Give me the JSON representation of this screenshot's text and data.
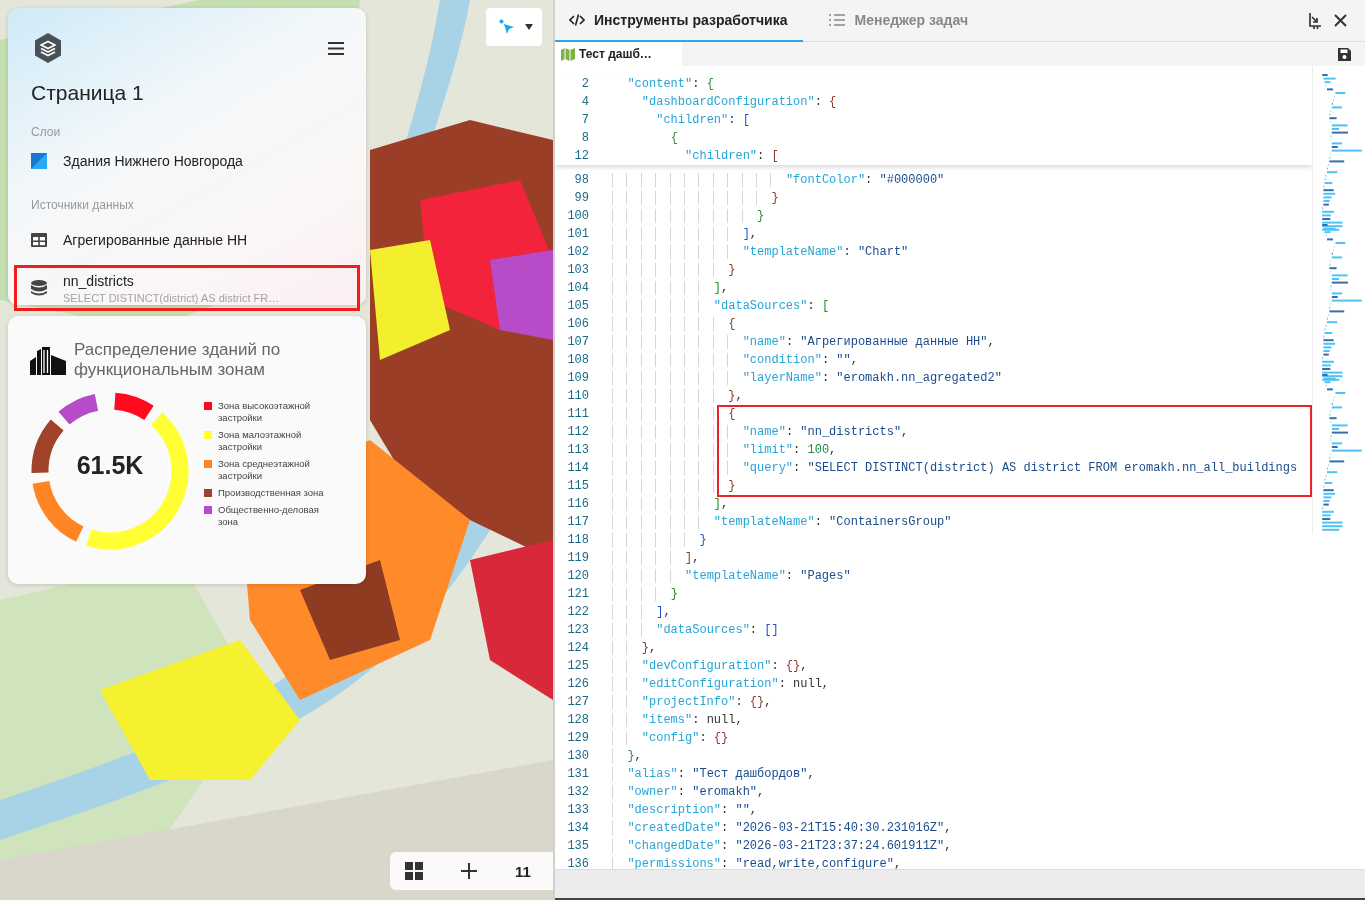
{
  "map_controls": {
    "zoom_level": "11"
  },
  "page_panel": {
    "title": "Страница 1",
    "layers_heading": "Слои",
    "layers": [
      {
        "name": "Здания Нижнего Новгорода"
      }
    ],
    "sources_heading": "Источники данных",
    "sources": [
      {
        "kind": "table",
        "name": "Агрегированные данные НН",
        "highlighted": false
      },
      {
        "kind": "database",
        "name": "nn_districts",
        "query": "SELECT DISTINCT(district) AS district FR…",
        "highlighted": true
      }
    ]
  },
  "chart_card": {
    "title": "Распределение зданий по функциональным зонам",
    "total": "61.5K",
    "legend": [
      {
        "label": "Зона высокоэтажной застройки",
        "color": "#ff0a1f"
      },
      {
        "label": "Зона малоэтажной застройки",
        "color": "#ffff33"
      },
      {
        "label": "Зона среднеэтажной застройки",
        "color": "#ff8424"
      },
      {
        "label": "Производственная зона",
        "color": "#a0432a"
      },
      {
        "label": "Общественно-деловая зона",
        "color": "#b64cc8"
      }
    ]
  },
  "devtools": {
    "tabs": [
      {
        "label": "Инструменты разработчика",
        "selected": true
      },
      {
        "label": "Менеджер задач",
        "selected": false
      }
    ],
    "file_tab": {
      "label": "Тест дашб…"
    },
    "sticky_lines": [
      {
        "number": "2",
        "text": "  \"content\": {"
      },
      {
        "number": "4",
        "text": "    \"dashboardConfiguration\": {"
      },
      {
        "number": "7",
        "text": "      \"children\": ["
      },
      {
        "number": "8",
        "text": "        {"
      },
      {
        "number": "12",
        "text": "          \"children\": ["
      }
    ],
    "lines": [
      {
        "number": "98",
        "text": "                        \"fontColor\": \"#000000\"",
        "highlighted": false
      },
      {
        "number": "99",
        "text": "                      }",
        "highlighted": false
      },
      {
        "number": "100",
        "text": "                    }",
        "highlighted": false
      },
      {
        "number": "101",
        "text": "                  ],",
        "highlighted": false
      },
      {
        "number": "102",
        "text": "                  \"templateName\": \"Chart\"",
        "highlighted": false
      },
      {
        "number": "103",
        "text": "                }",
        "highlighted": false
      },
      {
        "number": "104",
        "text": "              ],",
        "highlighted": false
      },
      {
        "number": "105",
        "text": "              \"dataSources\": [",
        "highlighted": false
      },
      {
        "number": "106",
        "text": "                {",
        "highlighted": false
      },
      {
        "number": "107",
        "text": "                  \"name\": \"Агрегированные данные НН\",",
        "highlighted": false
      },
      {
        "number": "108",
        "text": "                  \"condition\": \"\",",
        "highlighted": false
      },
      {
        "number": "109",
        "text": "                  \"layerName\": \"eromakh.nn_agregated2\"",
        "highlighted": false
      },
      {
        "number": "110",
        "text": "                },",
        "highlighted": false
      },
      {
        "number": "111",
        "text": "                {",
        "highlighted": true
      },
      {
        "number": "112",
        "text": "                  \"name\": \"nn_districts\",",
        "highlighted": true
      },
      {
        "number": "113",
        "text": "                  \"limit\": 100,",
        "highlighted": true
      },
      {
        "number": "114",
        "text": "                  \"query\": \"SELECT DISTINCT(district) AS district FROM eromakh.nn_all_buildings",
        "highlighted": true
      },
      {
        "number": "115",
        "text": "                }",
        "highlighted": true
      },
      {
        "number": "116",
        "text": "              ],",
        "highlighted": false
      },
      {
        "number": "117",
        "text": "              \"templateName\": \"ContainersGroup\"",
        "highlighted": false
      },
      {
        "number": "118",
        "text": "            }",
        "highlighted": false
      },
      {
        "number": "119",
        "text": "          ],",
        "highlighted": false
      },
      {
        "number": "120",
        "text": "          \"templateName\": \"Pages\"",
        "highlighted": false
      },
      {
        "number": "121",
        "text": "        }",
        "highlighted": false
      },
      {
        "number": "122",
        "text": "      ],",
        "highlighted": false
      },
      {
        "number": "123",
        "text": "      \"dataSources\": []",
        "highlighted": false
      },
      {
        "number": "124",
        "text": "    },",
        "highlighted": false
      },
      {
        "number": "125",
        "text": "    \"devConfiguration\": {},",
        "highlighted": false
      },
      {
        "number": "126",
        "text": "    \"editConfiguration\": null,",
        "highlighted": false
      },
      {
        "number": "127",
        "text": "    \"projectInfo\": {},",
        "highlighted": false
      },
      {
        "number": "128",
        "text": "    \"items\": null,",
        "highlighted": false
      },
      {
        "number": "129",
        "text": "    \"config\": {}",
        "highlighted": false
      },
      {
        "number": "130",
        "text": "  },",
        "highlighted": false
      },
      {
        "number": "131",
        "text": "  \"alias\": \"Тест дашбордов\",",
        "highlighted": false
      },
      {
        "number": "132",
        "text": "  \"owner\": \"eromakh\",",
        "highlighted": false
      },
      {
        "number": "133",
        "text": "  \"description\": \"\",",
        "highlighted": false
      },
      {
        "number": "134",
        "text": "  \"createdDate\": \"2026-03-21T15:40:30.231016Z\",",
        "highlighted": false
      },
      {
        "number": "135",
        "text": "  \"changedDate\": \"2026-03-21T23:37:24.601911Z\",",
        "highlighted": false
      },
      {
        "number": "136",
        "text": "  \"permissions\": \"read,write,configure\",",
        "highlighted": false
      }
    ]
  }
}
